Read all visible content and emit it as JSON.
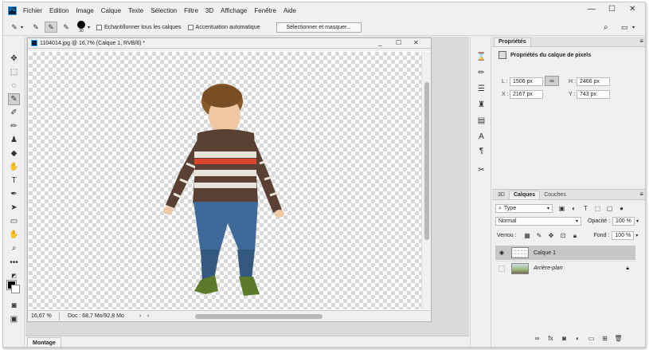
{
  "menu": {
    "logo": "Ps",
    "items": [
      "Fichier",
      "Edition",
      "Image",
      "Calque",
      "Texte",
      "Sélection",
      "Filtre",
      "3D",
      "Affichage",
      "Fenêtre",
      "Aide"
    ]
  },
  "window_controls": {
    "minimize": "—",
    "maximize": "☐",
    "close": "✕"
  },
  "options": {
    "brush_size": "30",
    "sample_all_label": "Echantillonner tous les calques",
    "auto_enhance_label": "Accentuation automatique",
    "select_mask_button": "Sélectionner et masquer..."
  },
  "document": {
    "title": "1104014.jpg @ 16,7% (Calque 1, RVB/8) *",
    "zoom": "16,67 %",
    "doc_info": "Doc : 68,7 Mo/92,8 Mo",
    "doc_ctl": {
      "minimize": "_",
      "maximize": "☐",
      "close": "✕"
    }
  },
  "workspace": {
    "montage_tab": "Montage"
  },
  "properties": {
    "tab": "Propriétés",
    "heading": "Propriétés du calque de pixels",
    "L_label": "L :",
    "L_value": "1506 px",
    "H_label": "H :",
    "H_value": "2466 px",
    "X_label": "X :",
    "X_value": "2167 px",
    "Y_label": "Y :",
    "Y_value": "743 px"
  },
  "layers_panel": {
    "tabs": [
      "3D",
      "Calques",
      "Couches"
    ],
    "active_tab": "Calques",
    "filter_label": "Type",
    "blend_mode": "Normal",
    "opacity_label": "Opacité :",
    "opacity_value": "100 %",
    "lock_label": "Verrou :",
    "fill_label": "Fond :",
    "fill_value": "100 %",
    "layers": [
      {
        "name": "Calque 1",
        "visible": true,
        "selected": true
      },
      {
        "name": "Arrière-plan",
        "visible": false,
        "selected": false,
        "locked": true
      }
    ]
  }
}
